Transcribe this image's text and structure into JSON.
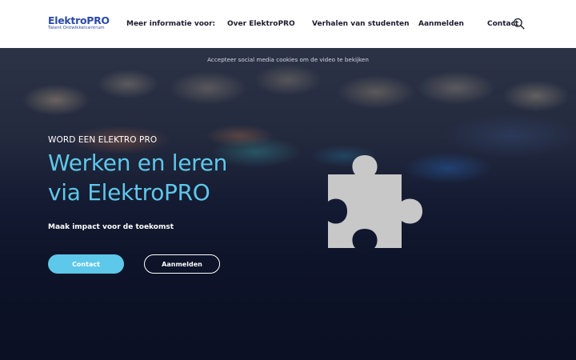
{
  "header": {
    "logo": {
      "main_text": "ElektroPRO",
      "sub_text": "Talent Ontwikkelcentrum"
    },
    "nav": [
      {
        "label": "Meer informatie voor:"
      },
      {
        "label": "Over ElektroPRO"
      },
      {
        "label": "Verhalen van studenten"
      },
      {
        "label": "Aanmelden"
      },
      {
        "label": "Contact"
      }
    ],
    "search_icon": "search-icon"
  },
  "hero": {
    "cookie_note": "Accepteer social media cookies om de video te bekijken",
    "kicker": "WORD EEN ELEKTRO PRO",
    "headline_line1": "Werken en leren",
    "headline_line2": "via ElektroPRO",
    "subline": "Maak impact voor de toekomst",
    "buttons": {
      "contact": "Contact",
      "aanmelden": "Aanmelden"
    },
    "placeholder_icon": "puzzle-piece-icon"
  },
  "colors": {
    "brand_blue": "#2b4aa6",
    "accent_cyan": "#5ec8ea",
    "hero_dark": "#0d1328",
    "puzzle_gray": "#c8c8c8"
  }
}
